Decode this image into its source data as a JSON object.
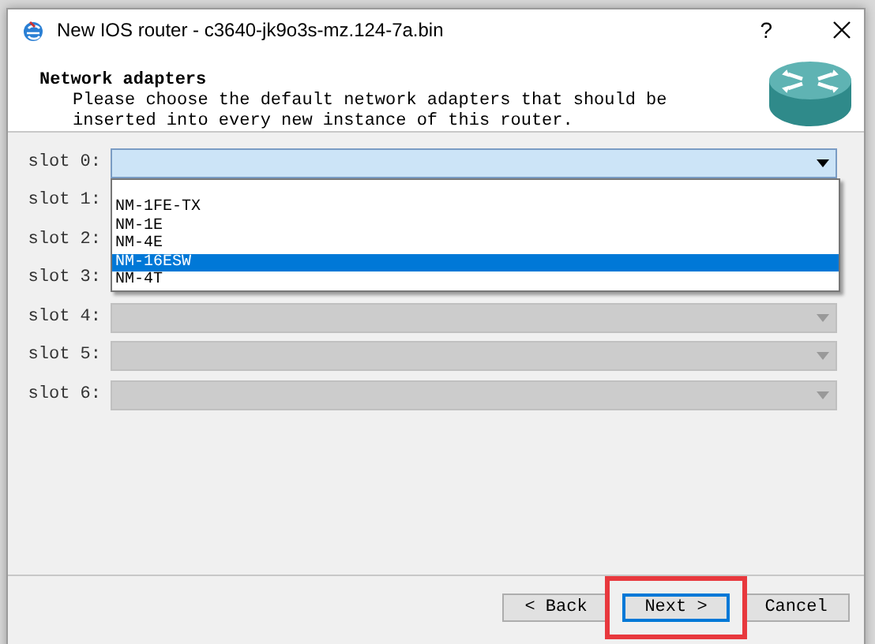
{
  "window": {
    "title": "New IOS router - c3640-jk9o3s-mz.124-7a.bin",
    "help": "?"
  },
  "header": {
    "title": "Network adapters",
    "description": "Please choose the default network adapters that should be inserted into every new instance of this router."
  },
  "slots": [
    {
      "label": "slot 0:",
      "kind": "open"
    },
    {
      "label": "slot 1:",
      "kind": "covered"
    },
    {
      "label": "slot 2:",
      "kind": "covered"
    },
    {
      "label": "slot 3:",
      "kind": "covered"
    },
    {
      "label": "slot 4:",
      "kind": "disabled"
    },
    {
      "label": "slot 5:",
      "kind": "disabled"
    },
    {
      "label": "slot 6:",
      "kind": "disabled"
    }
  ],
  "dropdown": {
    "options": [
      {
        "label": "NM-1FE-TX",
        "selected": false
      },
      {
        "label": "NM-1E",
        "selected": false
      },
      {
        "label": "NM-4E",
        "selected": false
      },
      {
        "label": "NM-16ESW",
        "selected": true
      },
      {
        "label": "NM-4T",
        "selected": false
      }
    ]
  },
  "buttons": [
    {
      "label": "< Back",
      "focused": false,
      "highlighted": false
    },
    {
      "label": "Next >",
      "focused": true,
      "highlighted": true
    },
    {
      "label": "Cancel",
      "focused": false,
      "highlighted": false
    }
  ]
}
